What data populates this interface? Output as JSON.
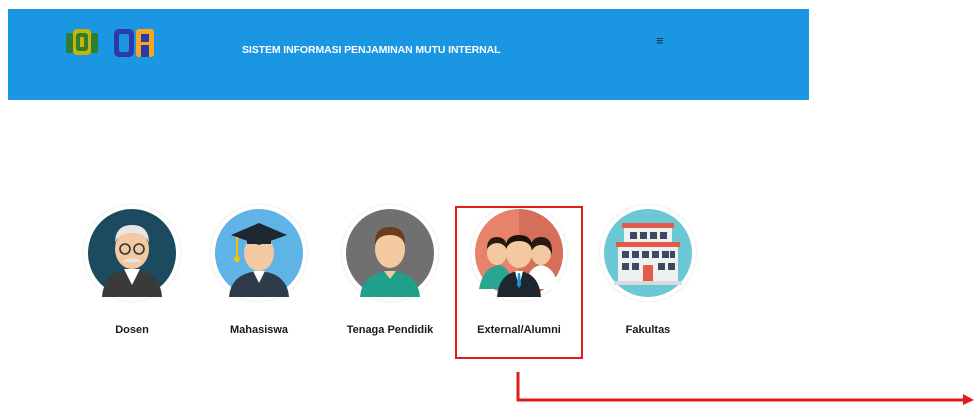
{
  "header": {
    "title": "SISTEM INFORMASI PENJAMINAN MUTU INTERNAL",
    "menu_icon": "hamburger-icon",
    "background": "#1a96e2"
  },
  "roles": [
    {
      "label": "Dosen",
      "icon": "lecturer-icon"
    },
    {
      "label": "Mahasiswa",
      "icon": "student-graduate-icon"
    },
    {
      "label": "Tenaga Pendidik",
      "icon": "staff-icon"
    },
    {
      "label": "External/Alumni",
      "icon": "alumni-group-icon"
    },
    {
      "label": "Fakultas",
      "icon": "faculty-building-icon"
    }
  ],
  "annotation": {
    "highlight_color": "#e01d1d",
    "highlighted_role": "External/Alumni"
  }
}
